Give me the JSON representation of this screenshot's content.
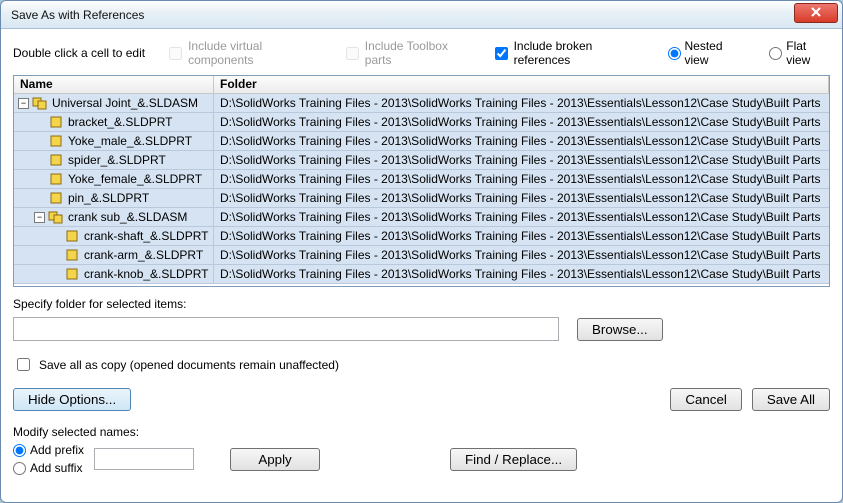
{
  "window": {
    "title": "Save As with References"
  },
  "toprow": {
    "hint": "Double click a cell to edit",
    "include_virtual": "Include virtual components",
    "include_toolbox": "Include Toolbox parts",
    "include_broken": "Include broken references",
    "nested": "Nested view",
    "flat": "Flat view"
  },
  "grid": {
    "headers": {
      "name": "Name",
      "folder": "Folder"
    },
    "rows": [
      {
        "indent": 0,
        "expander": "minus",
        "icon": "asm",
        "name": "Universal Joint_&.SLDASM",
        "folder": "D:\\SolidWorks Training Files - 2013\\SolidWorks Training Files - 2013\\Essentials\\Lesson12\\Case Study\\Built Parts"
      },
      {
        "indent": 1,
        "expander": "none",
        "icon": "prt",
        "name": "bracket_&.SLDPRT",
        "folder": "D:\\SolidWorks Training Files - 2013\\SolidWorks Training Files - 2013\\Essentials\\Lesson12\\Case Study\\Built Parts"
      },
      {
        "indent": 1,
        "expander": "none",
        "icon": "prt",
        "name": "Yoke_male_&.SLDPRT",
        "folder": "D:\\SolidWorks Training Files - 2013\\SolidWorks Training Files - 2013\\Essentials\\Lesson12\\Case Study\\Built Parts"
      },
      {
        "indent": 1,
        "expander": "none",
        "icon": "prt",
        "name": "spider_&.SLDPRT",
        "folder": "D:\\SolidWorks Training Files - 2013\\SolidWorks Training Files - 2013\\Essentials\\Lesson12\\Case Study\\Built Parts"
      },
      {
        "indent": 1,
        "expander": "none",
        "icon": "prt",
        "name": "Yoke_female_&.SLDPRT",
        "folder": "D:\\SolidWorks Training Files - 2013\\SolidWorks Training Files - 2013\\Essentials\\Lesson12\\Case Study\\Built Parts"
      },
      {
        "indent": 1,
        "expander": "none",
        "icon": "prt",
        "name": "pin_&.SLDPRT",
        "folder": "D:\\SolidWorks Training Files - 2013\\SolidWorks Training Files - 2013\\Essentials\\Lesson12\\Case Study\\Built Parts"
      },
      {
        "indent": 1,
        "expander": "minus",
        "icon": "asm",
        "name": "crank sub_&.SLDASM",
        "folder": "D:\\SolidWorks Training Files - 2013\\SolidWorks Training Files - 2013\\Essentials\\Lesson12\\Case Study\\Built Parts"
      },
      {
        "indent": 2,
        "expander": "none",
        "icon": "prt",
        "name": "crank-shaft_&.SLDPRT",
        "folder": "D:\\SolidWorks Training Files - 2013\\SolidWorks Training Files - 2013\\Essentials\\Lesson12\\Case Study\\Built Parts"
      },
      {
        "indent": 2,
        "expander": "none",
        "icon": "prt",
        "name": "crank-arm_&.SLDPRT",
        "folder": "D:\\SolidWorks Training Files - 2013\\SolidWorks Training Files - 2013\\Essentials\\Lesson12\\Case Study\\Built Parts"
      },
      {
        "indent": 2,
        "expander": "none",
        "icon": "prt",
        "name": "crank-knob_&.SLDPRT",
        "folder": "D:\\SolidWorks Training Files - 2013\\SolidWorks Training Files - 2013\\Essentials\\Lesson12\\Case Study\\Built Parts"
      }
    ]
  },
  "specify_label": "Specify folder for selected items:",
  "specify_value": "",
  "browse": "Browse...",
  "save_copy": "Save all as copy (opened documents remain unaffected)",
  "hide_options": "Hide Options...",
  "cancel": "Cancel",
  "save_all": "Save All",
  "modify_label": "Modify selected names:",
  "add_prefix": "Add prefix",
  "add_suffix": "Add suffix",
  "prefix_value": "",
  "apply": "Apply",
  "find_replace": "Find / Replace..."
}
